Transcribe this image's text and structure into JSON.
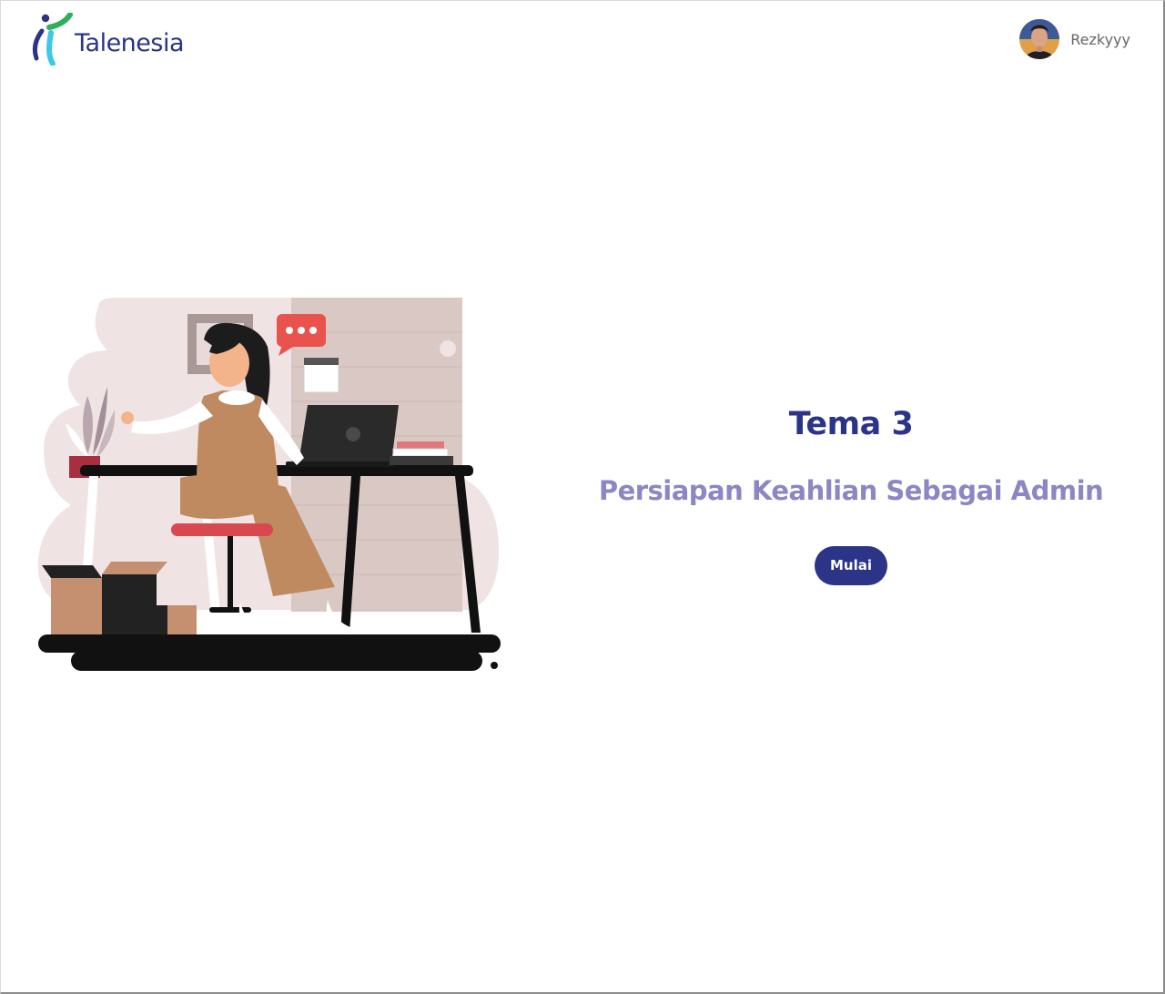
{
  "header": {
    "logo_text": "Talenesia",
    "user_name": "Rezkyyy"
  },
  "main": {
    "title": "Tema 3",
    "subtitle": "Persiapan Keahlian Sebagai Admin",
    "start_button_label": "Mulai"
  },
  "colors": {
    "brand_blue": "#2b3487",
    "subtitle_purple": "#8c86c4",
    "logo_green": "#2fae5b",
    "logo_cyan": "#3cc8e8"
  },
  "icons": {
    "logo": "talenesia-logo-icon",
    "avatar": "user-avatar",
    "illustration": "office-woman-illustration"
  }
}
